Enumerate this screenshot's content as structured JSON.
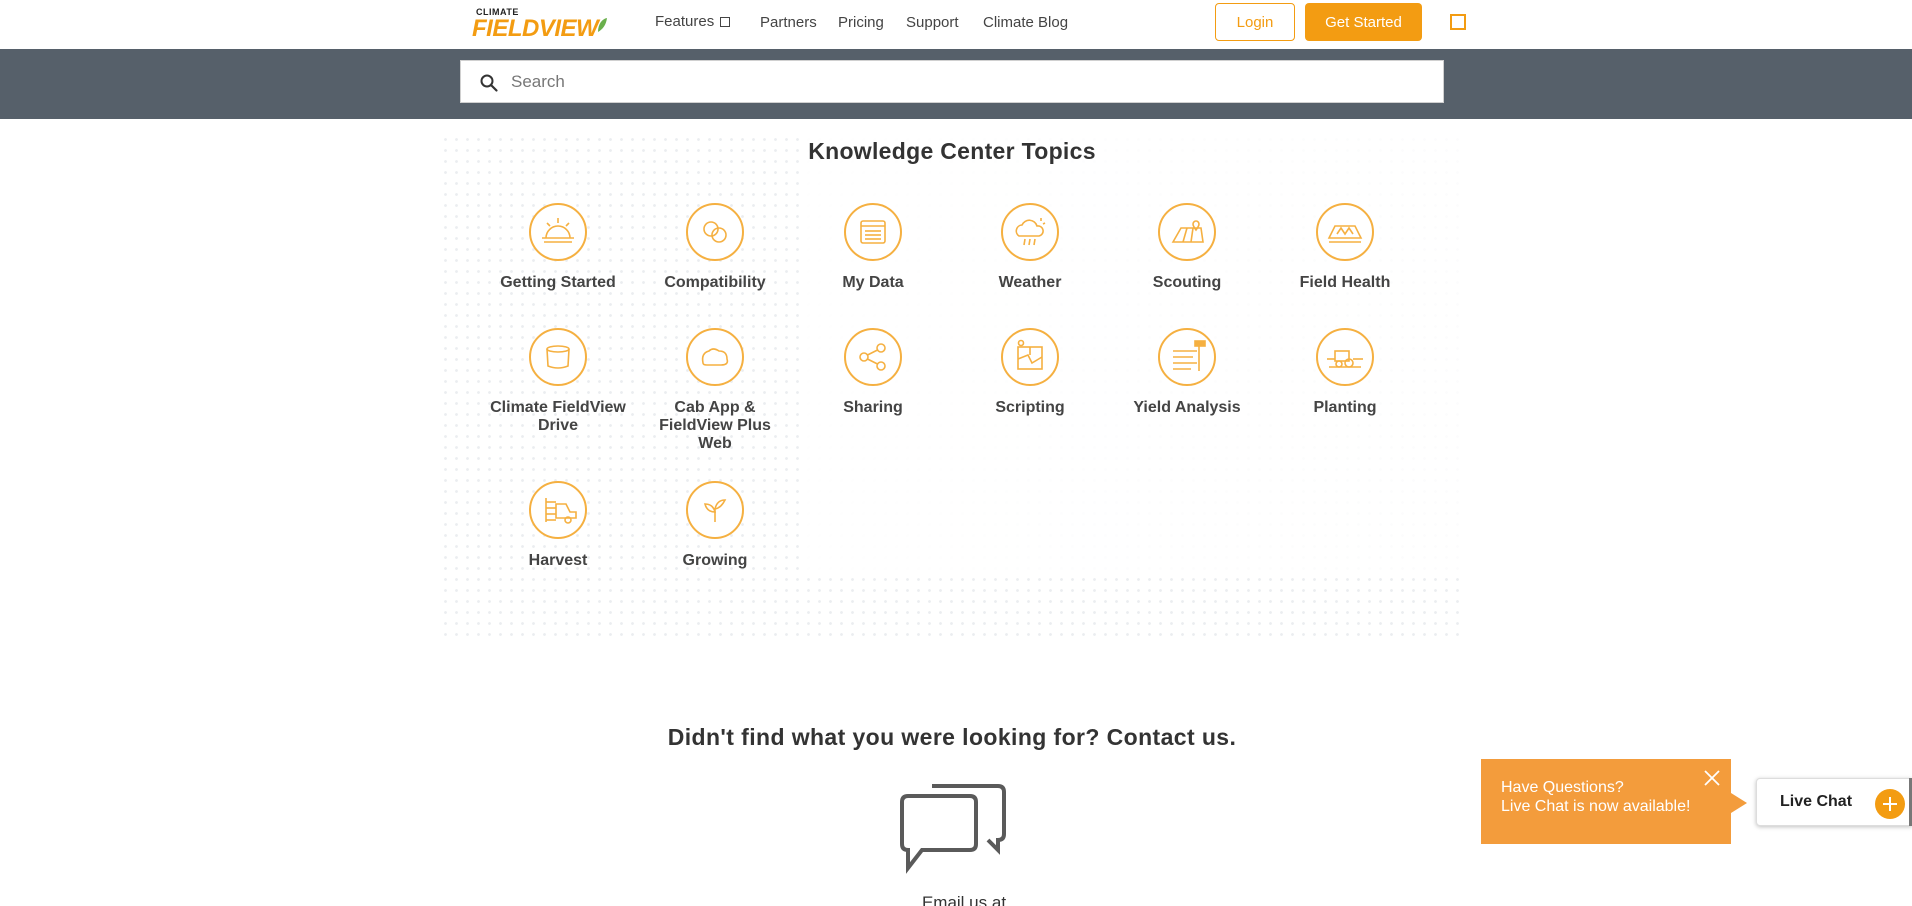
{
  "header": {
    "logo_small": "CLIMATE",
    "logo_big": "FIELDVIEW",
    "nav": {
      "features": "Features",
      "partners": "Partners",
      "pricing": "Pricing",
      "support": "Support",
      "blog": "Climate Blog"
    },
    "login": "Login",
    "get_started": "Get Started"
  },
  "search": {
    "placeholder": "Search"
  },
  "topics": {
    "title": "Knowledge Center Topics",
    "items": [
      {
        "label": "Getting Started",
        "icon": "sunrise-icon"
      },
      {
        "label": "Compatibility",
        "icon": "compatibility-icon"
      },
      {
        "label": "My Data",
        "icon": "data-table-icon"
      },
      {
        "label": "Weather",
        "icon": "weather-icon"
      },
      {
        "label": "Scouting",
        "icon": "field-pin-icon"
      },
      {
        "label": "Field Health",
        "icon": "field-health-icon"
      },
      {
        "label": "Climate FieldView Drive",
        "icon": "drive-device-icon"
      },
      {
        "label": "Cab App & FieldView Plus Web",
        "icon": "tractor-cab-icon"
      },
      {
        "label": "Sharing",
        "icon": "share-icon"
      },
      {
        "label": "Scripting",
        "icon": "map-script-icon"
      },
      {
        "label": "Yield Analysis",
        "icon": "yield-chart-icon"
      },
      {
        "label": "Planting",
        "icon": "planter-icon"
      },
      {
        "label": "Harvest",
        "icon": "combine-icon"
      },
      {
        "label": "Growing",
        "icon": "sprout-icon"
      }
    ]
  },
  "contact": {
    "title": "Didn't find what you were looking for? Contact us.",
    "email_text": "Email us at"
  },
  "live_chat": {
    "callout_line1": "Have Questions?",
    "callout_line2": "Live Chat is now available!",
    "button_label": "Live Chat"
  },
  "colors": {
    "accent": "#f39c12",
    "search_band": "#56606a",
    "callout": "#f39c3c"
  }
}
